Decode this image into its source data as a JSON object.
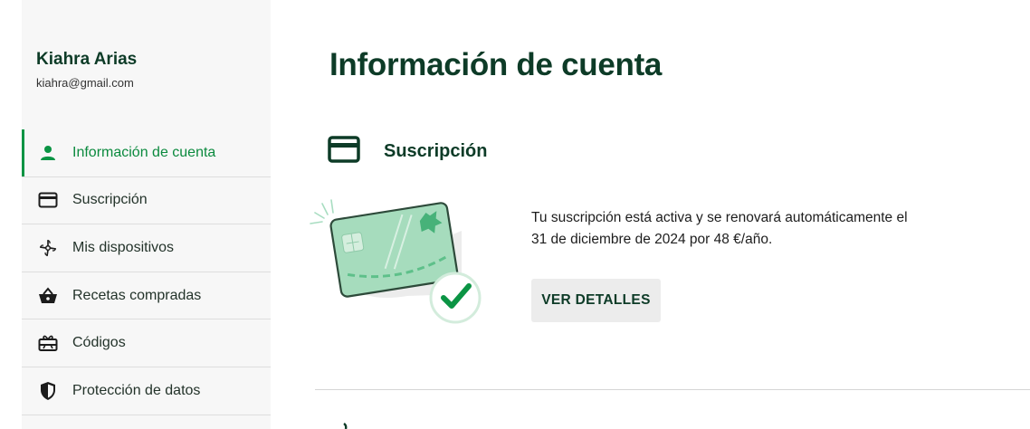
{
  "user": {
    "name": "Kiahra Arias",
    "email": "kiahra@gmail.com"
  },
  "nav": {
    "items": [
      {
        "label": "Información de cuenta",
        "icon": "person-icon",
        "active": true
      },
      {
        "label": "Suscripción",
        "icon": "credit-card-icon"
      },
      {
        "label": "Mis dispositivos",
        "icon": "devices-icon"
      },
      {
        "label": "Recetas compradas",
        "icon": "basket-icon"
      },
      {
        "label": "Códigos",
        "icon": "gift-card-icon"
      },
      {
        "label": "Protección de datos",
        "icon": "shield-icon"
      }
    ]
  },
  "main": {
    "title": "Información de cuenta",
    "section": {
      "title": "Suscripción",
      "icon": "credit-card-icon",
      "description": "Tu suscripción está activa y se renovará automáticamente el 31 de diciembre de 2024 por 48 €/año.",
      "button_label": "VER DETALLES"
    }
  },
  "colors": {
    "brand_dark": "#0d3b27",
    "accent_green": "#0b9444",
    "sidebar_bg": "#f7f7f7",
    "button_bg": "#ececec"
  }
}
